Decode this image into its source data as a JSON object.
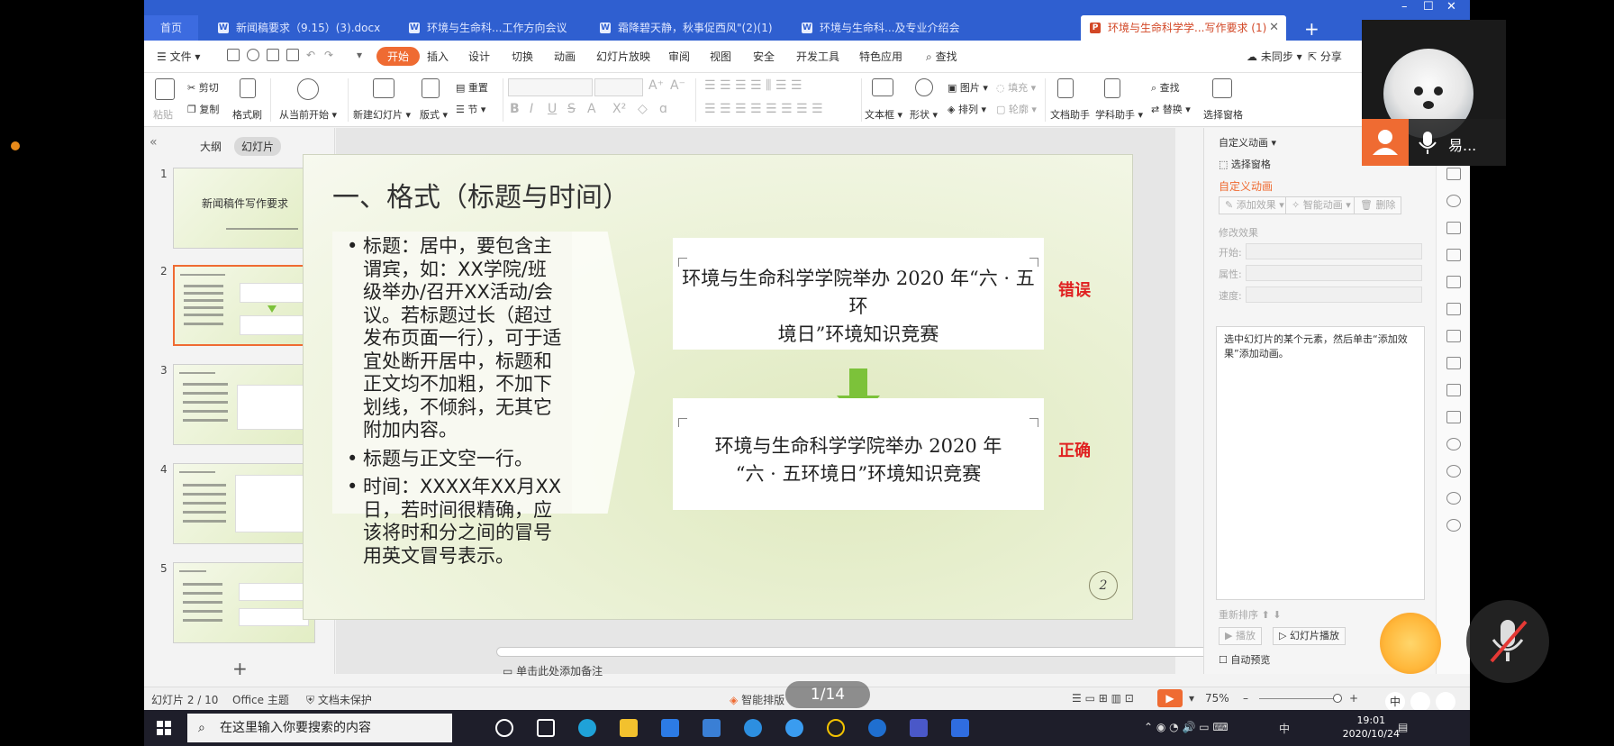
{
  "tabs": [
    {
      "label": "首页",
      "type": "home"
    },
    {
      "label": "新闻稿要求（9.15）(3).docx",
      "icon": "W"
    },
    {
      "label": "环境与生命科...工作方向会议",
      "icon": "W"
    },
    {
      "label": "霜降碧天静，秋事促西风\"(2)(1)",
      "icon": "W"
    },
    {
      "label": "环境与生命科...及专业介绍会",
      "icon": "W"
    },
    {
      "label": "环境与生命科学学...写作要求 (1)",
      "icon": "P",
      "active": true
    }
  ],
  "menu": {
    "file": "文件",
    "items": [
      "开始",
      "插入",
      "设计",
      "切换",
      "动画",
      "幻灯片放映",
      "审阅",
      "视图",
      "安全",
      "开发工具",
      "特色应用"
    ],
    "active": "开始",
    "search": "查找",
    "sync": "未同步",
    "share": "分享"
  },
  "ribbon": {
    "paste": "粘贴",
    "cut": "剪切",
    "copy": "复制",
    "format_painter": "格式刷",
    "play_from_current": "从当前开始",
    "new_slide": "新建幻灯片",
    "layout": "版式",
    "reset": "重置",
    "section": "节",
    "textbox": "文本框",
    "shape": "形状",
    "picture": "图片",
    "arrange": "排列",
    "fill": "填充",
    "outline": "轮廓",
    "doc_assistant": "文档助手",
    "subject_assistant": "学科助手",
    "find": "查找",
    "replace": "替换",
    "select_pane": "选择窗格"
  },
  "left_pane": {
    "tab_outline": "大纲",
    "tab_slides": "幻灯片",
    "slide1_title": "新闻稿件写作要求",
    "slide_numbers": [
      "1",
      "2",
      "3",
      "4",
      "5"
    ],
    "add": "+"
  },
  "slide": {
    "title": "一、格式（标题与时间）",
    "bullets": [
      "标题：居中，要包含主谓宾，如：XX学院/班级举办/召开XX活动/会议。若标题过长（超过发布页面一行），可于适宜处断开居中，标题和正文均不加粗，不加下划线，不倾斜，无其它附加内容。",
      "标题与正文空一行。",
      "时间：XXXX年XX月XX日，若时间很精确，应该将时和分之间的冒号用英文冒号表示。"
    ],
    "box_wrong_line1": "环境与生命科学学院举办 2020 年“六 · 五环",
    "box_wrong_line2": "境日”环境知识竞赛",
    "box_right_line1": "环境与生命科学学院举办 2020 年",
    "box_right_line2": "“六 · 五环境日”环境知识竞赛",
    "label_wrong": "错误",
    "label_right": "正确",
    "page_number": "2",
    "accent_green": "#7cc23a",
    "accent_red": "#e02020"
  },
  "notes_placeholder": "单击此处添加备注",
  "right_pane": {
    "header": "自定义动画",
    "select_pane": "选择窗格",
    "section_title": "自定义动画",
    "add_effect": "添加效果",
    "smart_animation": "智能动画",
    "delete": "删除",
    "modify_effect": "修改效果",
    "start_label": "开始:",
    "property_label": "属性:",
    "speed_label": "速度:",
    "hint": "选中幻灯片的某个元素，然后单击“添加效果”添加动画。",
    "reorder": "重新排序",
    "play": "播放",
    "slideshow": "幻灯片播放",
    "autopreview": "自动预览"
  },
  "status": {
    "slide_pos": "幻灯片 2 / 10",
    "theme": "Office 主题",
    "protect": "文档未保护",
    "smart_layout": "智能排版",
    "zoom": "75%"
  },
  "overlay": {
    "page_counter": "1/14",
    "user_name": "易...",
    "ime": "中"
  },
  "taskbar": {
    "search_placeholder": "在这里输入你要搜索的内容",
    "ime": "中",
    "time": "19:01",
    "date": "2020/10/24"
  }
}
